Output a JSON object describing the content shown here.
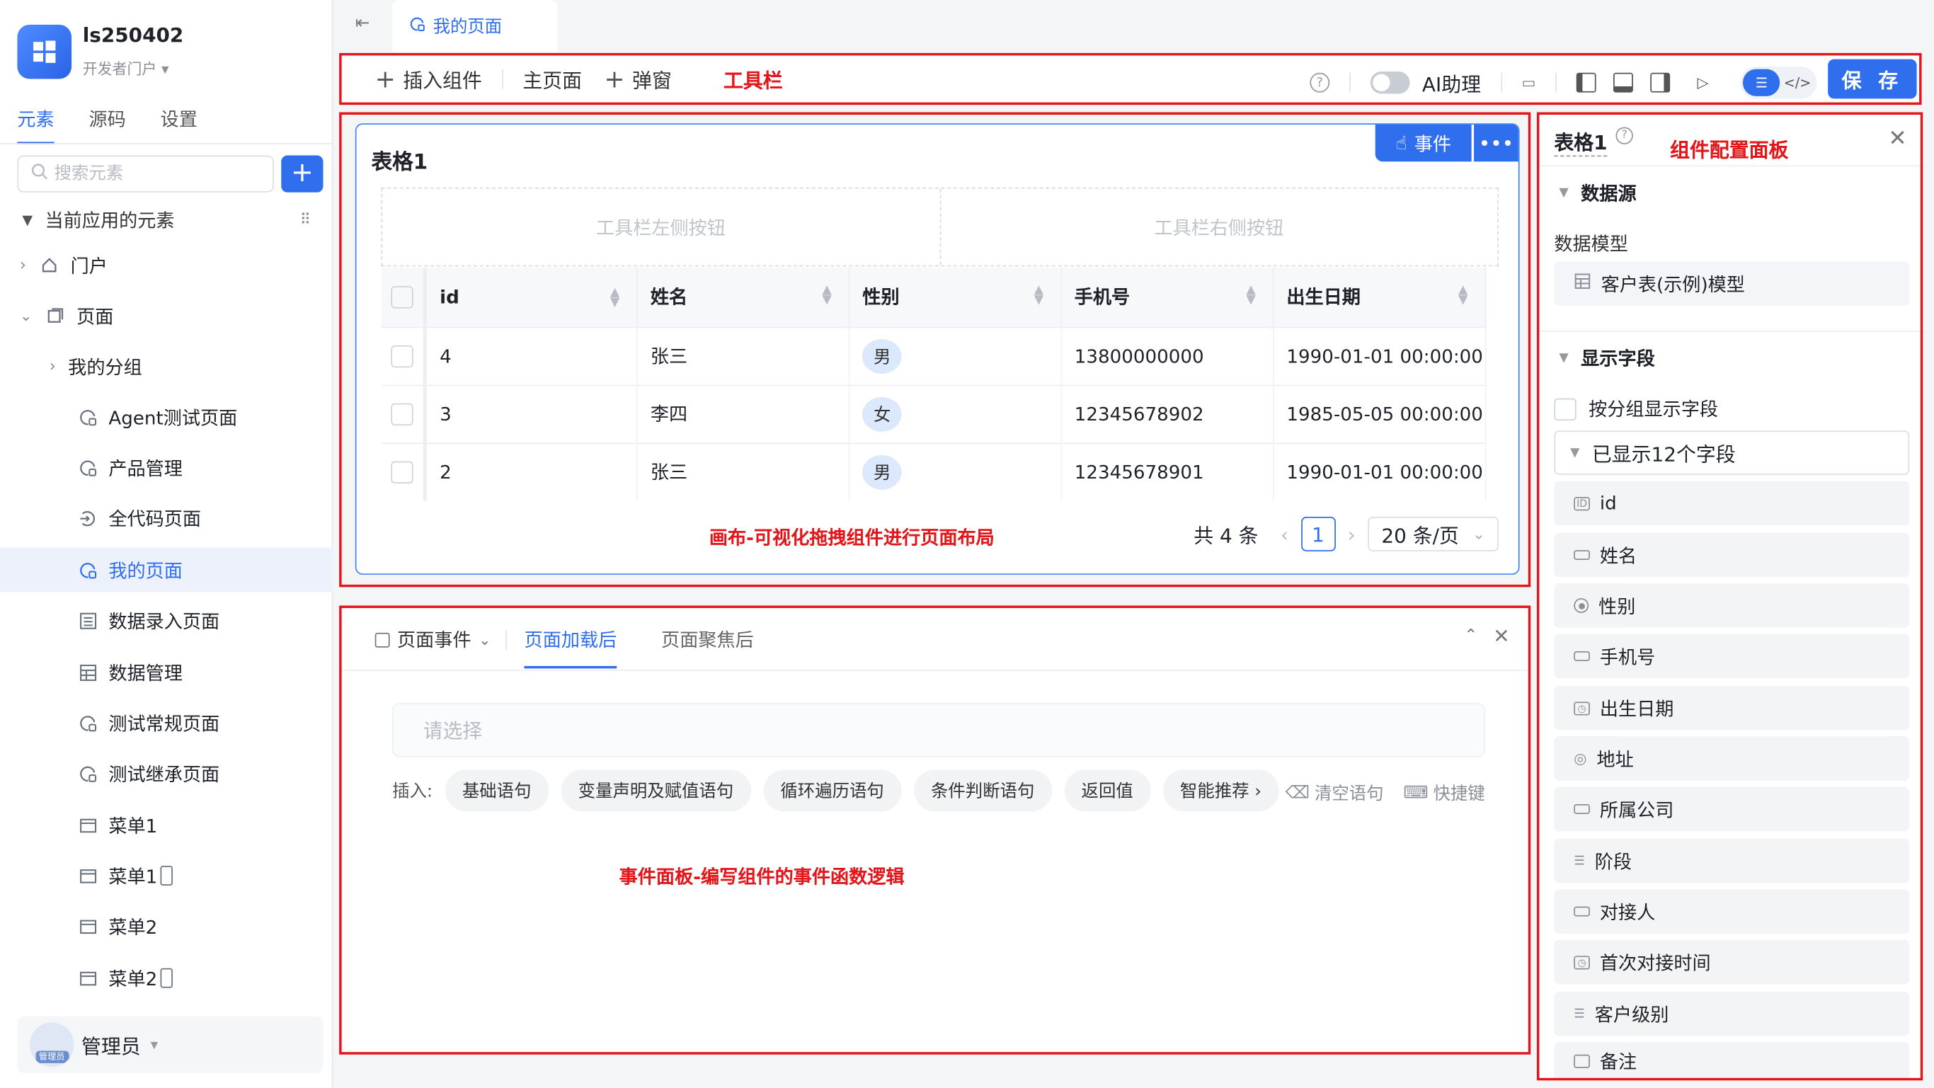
{
  "app": {
    "name": "ls250402",
    "subtitle": "开发者门户"
  },
  "side_tabs": [
    "元素",
    "源码",
    "设置"
  ],
  "search": {
    "placeholder": "搜索元素"
  },
  "add_label": "+",
  "tree": {
    "section_label": "当前应用的元素",
    "items": [
      {
        "label": "门户",
        "icon": "home-icon"
      },
      {
        "label": "页面",
        "icon": "pages-icon"
      },
      {
        "label": "我的分组",
        "icon": "folder-icon"
      },
      {
        "label": "Agent测试页面",
        "icon": "page-icon"
      },
      {
        "label": "产品管理",
        "icon": "page-icon"
      },
      {
        "label": "全代码页面",
        "icon": "code-page-icon"
      },
      {
        "label": "我的页面",
        "icon": "page-icon"
      },
      {
        "label": "数据录入页面",
        "icon": "form-icon"
      },
      {
        "label": "数据管理",
        "icon": "table-icon"
      },
      {
        "label": "测试常规页面",
        "icon": "page-icon"
      },
      {
        "label": "测试继承页面",
        "icon": "page-icon"
      },
      {
        "label": "菜单1",
        "icon": "menu-icon"
      },
      {
        "label": "菜单1",
        "icon": "menu-icon"
      },
      {
        "label": "菜单2",
        "icon": "menu-icon"
      },
      {
        "label": "菜单2",
        "icon": "menu-icon"
      }
    ]
  },
  "user": {
    "name": "管理员",
    "badge": "管理员"
  },
  "tabbar": {
    "active_tab": "我的页面"
  },
  "toolbar": {
    "insert_label": "插入组件",
    "main_page_label": "主页面",
    "popup_label": "弹窗",
    "ai_label": "AI助理",
    "ai_enabled": false,
    "save_label": "保 存"
  },
  "annotations": {
    "toolbar": "工具栏",
    "canvas": "画布-可视化拖拽组件进行页面布局",
    "events": "事件面板-编写组件的事件函数逻辑",
    "config": "组件配置面板"
  },
  "canvas": {
    "card_title": "表格1",
    "event_btn": "事件",
    "toolbar_left": "工具栏左侧按钮",
    "toolbar_right": "工具栏右侧按钮",
    "columns": [
      "id",
      "姓名",
      "性别",
      "手机号",
      "出生日期"
    ],
    "rows": [
      {
        "id": "4",
        "name": "张三",
        "gender": "男",
        "phone": "13800000000",
        "birth": "1990-01-01 00:00:00"
      },
      {
        "id": "3",
        "name": "李四",
        "gender": "女",
        "phone": "12345678902",
        "birth": "1985-05-05 00:00:00"
      },
      {
        "id": "2",
        "name": "张三",
        "gender": "男",
        "phone": "12345678901",
        "birth": "1990-01-01 00:00:00"
      }
    ],
    "pager": {
      "total": "共 4 条",
      "current": "1",
      "page_size": "20 条/页"
    }
  },
  "events": {
    "dropdown_label": "页面事件",
    "tabs": [
      "页面加载后",
      "页面聚焦后"
    ],
    "input_placeholder": "请选择",
    "insert_label": "插入:",
    "pills": [
      "基础语句",
      "变量声明及赋值语句",
      "循环遍历语句",
      "条件判断语句",
      "返回值",
      "智能推荐 ›"
    ],
    "clear_label": "清空语句",
    "shortcut_label": "快捷键"
  },
  "config": {
    "title": "表格1",
    "datasource_label": "数据源",
    "model_label": "数据模型",
    "model_value": "客户表(示例)模型",
    "fields_label": "显示字段",
    "group_label": "按分组显示字段",
    "shown_count": "已显示12个字段",
    "fields": [
      {
        "label": "id",
        "icon": "id-icon"
      },
      {
        "label": "姓名",
        "icon": "text-field-icon"
      },
      {
        "label": "性别",
        "icon": "radio-icon"
      },
      {
        "label": "手机号",
        "icon": "text-field-icon"
      },
      {
        "label": "出生日期",
        "icon": "date-icon"
      },
      {
        "label": "地址",
        "icon": "location-icon"
      },
      {
        "label": "所属公司",
        "icon": "text-field-icon"
      },
      {
        "label": "阶段",
        "icon": "select-icon"
      },
      {
        "label": "对接人",
        "icon": "text-field-icon"
      },
      {
        "label": "首次对接时间",
        "icon": "date-icon"
      },
      {
        "label": "客户级别",
        "icon": "select-icon"
      },
      {
        "label": "备注",
        "icon": "textarea-icon"
      }
    ]
  },
  "colors": {
    "accent": "#2f6fed",
    "annotation_red": "#e3171b",
    "selected_bg": "#ecf1fb"
  }
}
